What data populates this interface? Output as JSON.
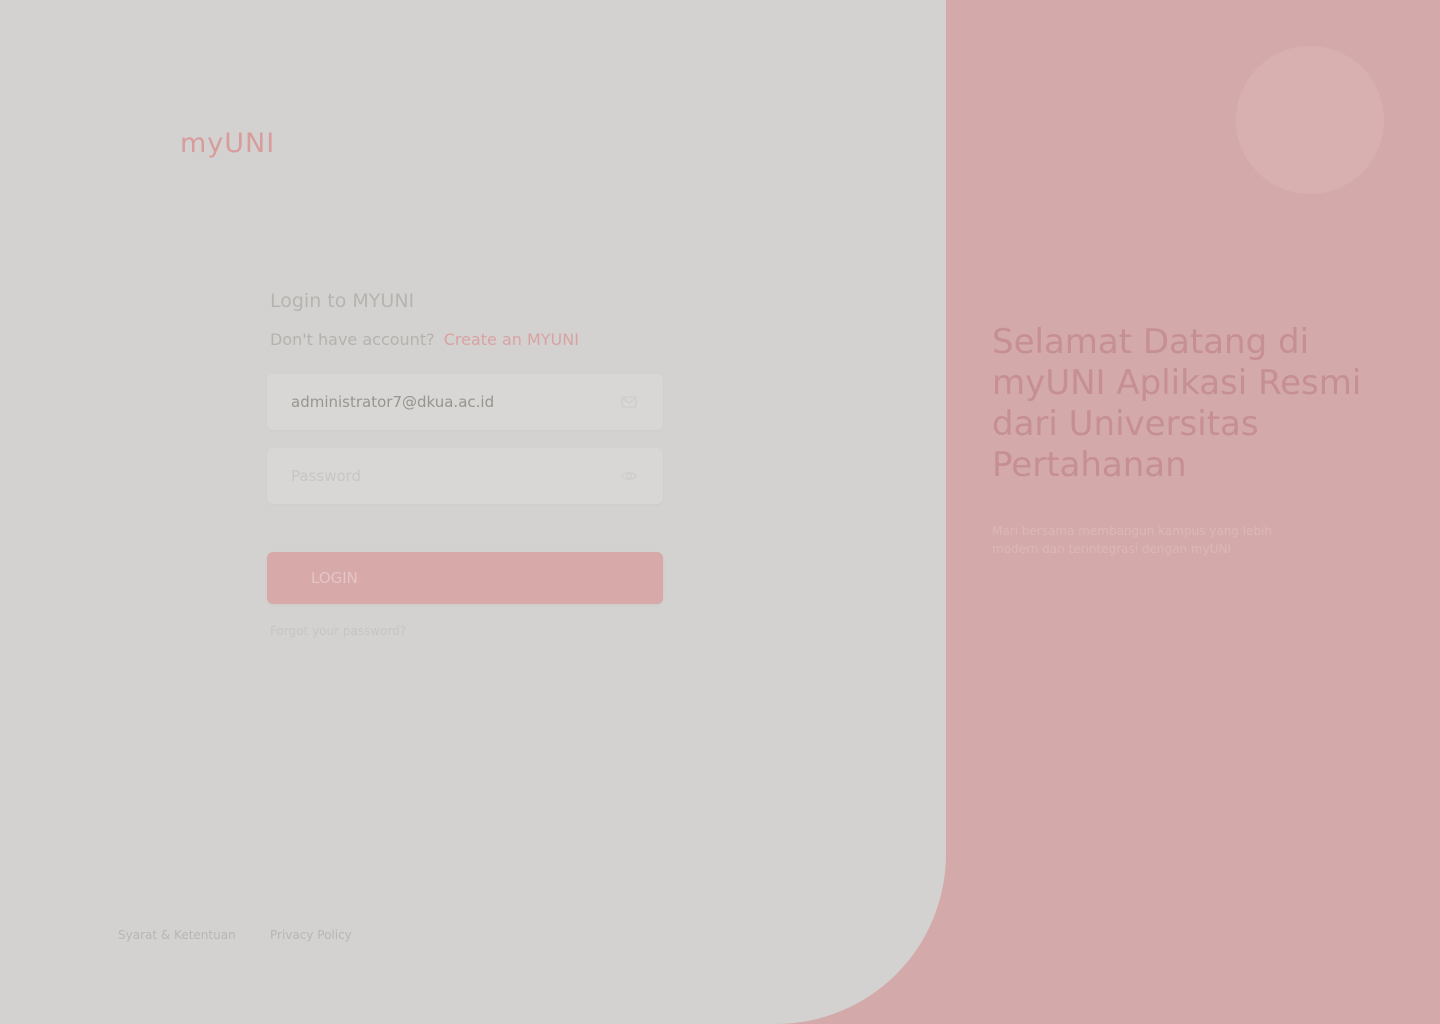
{
  "brand": {
    "logo_text": "myUNI"
  },
  "login": {
    "title": "Login to MYUNI",
    "signup_prompt": "Don't have account?",
    "signup_link": "Create an MYUNI",
    "email_value": "administrator7@dkua.ac.id",
    "password_placeholder": "Password",
    "submit_label": "LOGIN",
    "forgot_label": "Forgot your password?"
  },
  "icons": {
    "email": "mail-icon",
    "password": "eye-icon"
  },
  "footer": {
    "links": [
      "Syarat & Ketentuan",
      "Privacy Policy"
    ]
  },
  "welcome": {
    "title": "Selamat Datang di myUNI Aplikasi Resmi dari Universitas Pertahanan",
    "description": "Mari bersama membangun kampus yang lebih modern dan terintegrasi dengan myUNI"
  },
  "colors": {
    "panel_pink": "#d4a9a9",
    "card_grey": "#d3d2d0",
    "accent": "#d79c9c"
  }
}
